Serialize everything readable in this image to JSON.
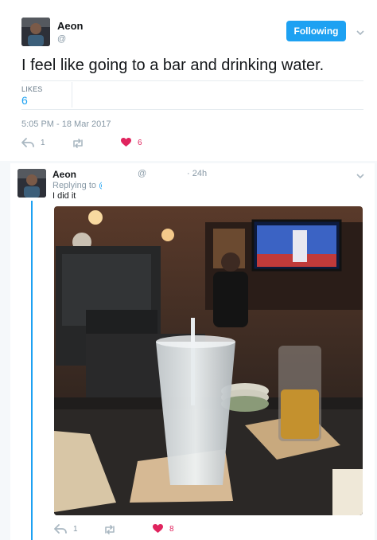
{
  "main_tweet": {
    "display_name": "Aeon",
    "handle_prefix": "@",
    "follow_label": "Following",
    "text": "I feel like going to a bar and drinking water.",
    "likes_label": "LIKES",
    "likes_count": "6",
    "timestamp": "5:05 PM - 18 Mar 2017",
    "reply_count": "1",
    "like_count_action": "6"
  },
  "reply_tweet": {
    "display_name": "Aeon",
    "handle_prefix": "@",
    "time": "· 24h",
    "replying_to_label": "Replying to",
    "replying_to_handle": "@",
    "text": "I did it",
    "reply_count": "1",
    "like_count_action": "8"
  },
  "colors": {
    "accent": "#1da1f2",
    "like": "#e0245e",
    "muted": "#8899a6",
    "background_alt": "#f5f8fa"
  },
  "icons": [
    "reply-icon",
    "retweet-icon",
    "heart-icon",
    "chevron-down-icon"
  ]
}
